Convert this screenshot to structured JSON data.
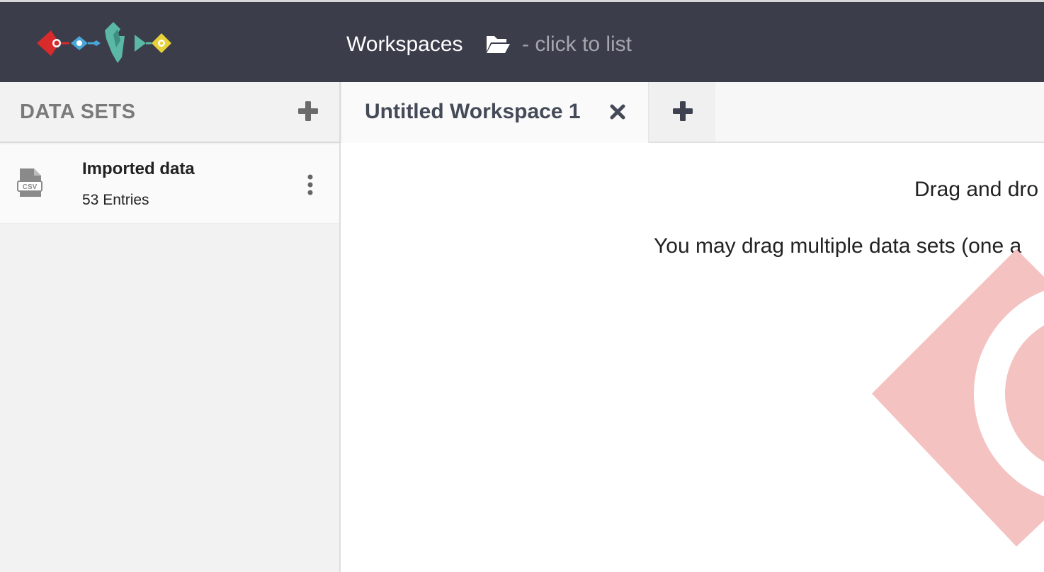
{
  "header": {
    "title": "Workspaces",
    "hint": "- click to list",
    "logo_icon": "codap-logo-icon",
    "folder_icon": "folder-open-icon"
  },
  "sidebar": {
    "title": "DATA SETS",
    "add_icon": "plus-icon",
    "datasets": [
      {
        "name": "Imported data",
        "entries": "53 Entries",
        "icon": "csv-file-icon"
      }
    ]
  },
  "tabs": {
    "items": [
      {
        "label": "Untitled Workspace 1"
      }
    ],
    "add_icon": "plus-icon"
  },
  "main": {
    "drop_line1": "Drag and dro",
    "drop_line2": "You may drag multiple data sets (one a"
  },
  "colors": {
    "header_bg": "#3b3d4a",
    "sidebar_bg": "#f2f2f2",
    "watermark": "#f4c2c0"
  }
}
